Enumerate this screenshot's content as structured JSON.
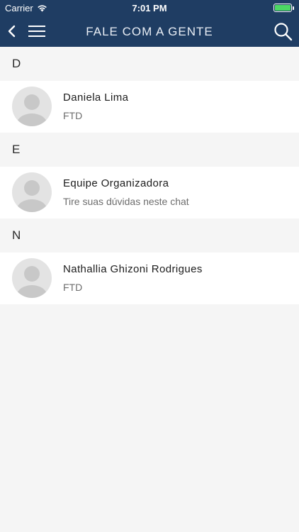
{
  "status_bar": {
    "carrier": "Carrier",
    "time": "7:01 PM",
    "battery_color": "#4cd964"
  },
  "nav": {
    "title": "FALE COM A GENTE",
    "background": "#1f3d63"
  },
  "sections": [
    {
      "letter": "D",
      "contacts": [
        {
          "name": "Daniela Lima",
          "subtitle": "FTD"
        }
      ]
    },
    {
      "letter": "E",
      "contacts": [
        {
          "name": "Equipe Organizadora",
          "subtitle": "Tire suas dúvidas neste chat"
        }
      ]
    },
    {
      "letter": "N",
      "contacts": [
        {
          "name": "Nathallia Ghizoni Rodrigues",
          "subtitle": "FTD"
        }
      ]
    }
  ],
  "icons": {
    "back": "chevron-left-icon",
    "menu": "hamburger-menu-icon",
    "search": "search-icon",
    "avatar": "user-placeholder-icon",
    "wifi": "wifi-icon",
    "battery": "battery-icon"
  }
}
